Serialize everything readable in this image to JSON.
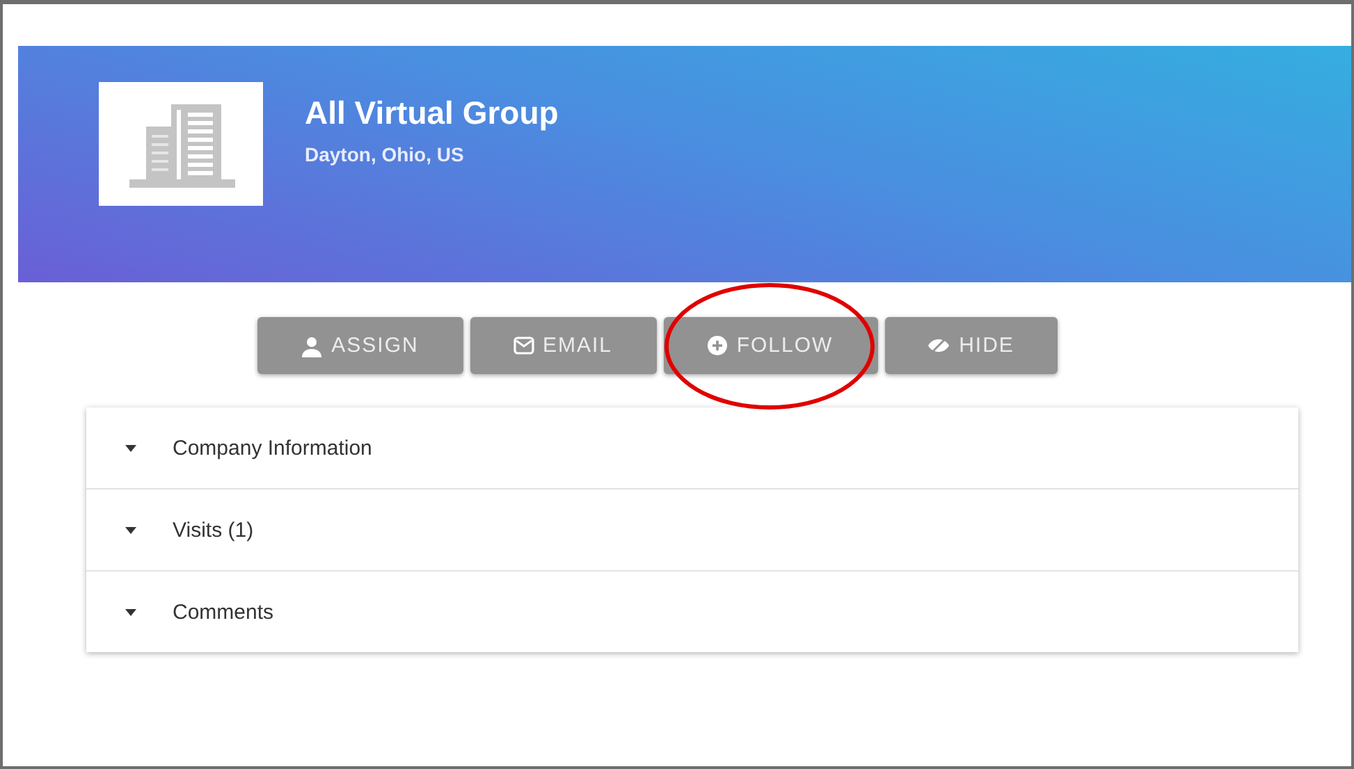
{
  "company": {
    "name": "All Virtual Group",
    "location": "Dayton, Ohio, US"
  },
  "actions": [
    "ASSIGN",
    "EMAIL",
    "FOLLOW",
    "HIDE"
  ],
  "sections": [
    {
      "label": "Company Information",
      "expanded": false
    },
    {
      "label": "Visits (1)",
      "expanded": false
    },
    {
      "label": "Comments",
      "expanded": false
    }
  ]
}
